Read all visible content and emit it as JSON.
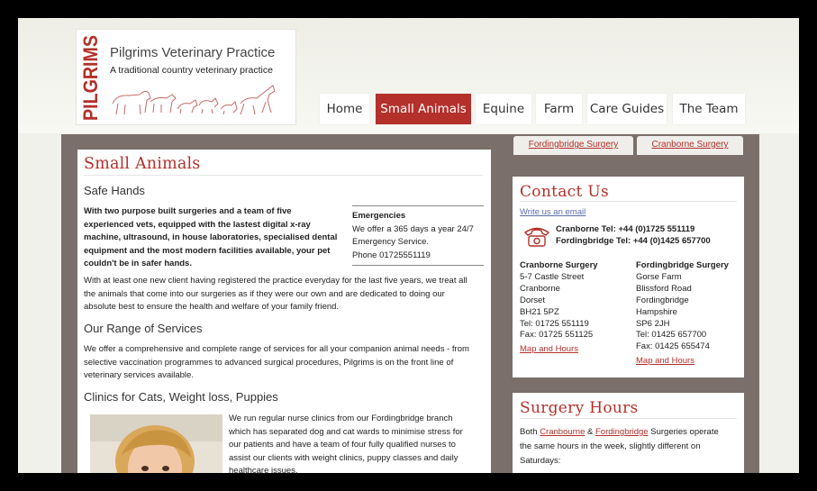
{
  "logo": {
    "vertical": "PILGRIMS",
    "name": "Pilgrims Veterinary Practice",
    "tagline": "A traditional country veterinary practice"
  },
  "nav": [
    {
      "label": "Home",
      "active": false
    },
    {
      "label": "Small Animals",
      "active": true
    },
    {
      "label": "Equine",
      "active": false
    },
    {
      "label": "Farm",
      "active": false
    },
    {
      "label": "Care Guides",
      "active": false
    },
    {
      "label": "The Team",
      "active": false
    }
  ],
  "tabs": [
    "Fordingbridge Surgery",
    "Cranborne Surgery"
  ],
  "main": {
    "title": "Small Animals",
    "safe_hands": {
      "heading": "Safe Hands",
      "bold_lines": [
        "With two purpose built surgeries and a team of five",
        "experienced vets, equipped with the lastest digital x-ray",
        "machine, ultrasound, in house laboratories, specialised dental",
        "equipment and the most modern facilities available, your pet",
        "couldn't be in safer hands."
      ],
      "para_lines": [
        "With at least one new client having registered the practice everyday for the last five years, we treat all",
        "the animals that come into our surgeries as if they were our own and are dedicated to doing our",
        "absolute best to ensure the health and welfare of your family friend."
      ]
    },
    "emergencies": {
      "title": "Emergencies",
      "lines": [
        "We offer a 365 days a year 24/7",
        "Emergency Service.",
        "Phone 01725551119"
      ]
    },
    "range": {
      "heading": "Our Range of Services",
      "lines": [
        "We offer a comprehensive and complete range of services for all your companion animal needs - from",
        "selective vaccination programmes to advanced surgical procedures, Pilgrims is on the front line of",
        "veterinary services available."
      ]
    },
    "clinics": {
      "heading": "Clinics for Cats, Weight loss, Puppies",
      "lines": [
        "We run regular nurse clinics from our Fordingbridge branch",
        "which has separated dog and cat wards to minimise stress for",
        "our patients and have a team of four fully qualified nurses to",
        "assist our clients with weight clinics, puppy classes and daily",
        "healthcare issues."
      ]
    }
  },
  "contact": {
    "title": "Contact Us",
    "email_link": "Write us an email",
    "phones": [
      "Cranborne Tel: +44 (0)1725 551119",
      "Fordingbridge Tel: +44 (0)1425 657700"
    ],
    "cranborne": {
      "title": "Cranborne Surgery",
      "lines": [
        "5-7 Castle Street",
        "Cranborne",
        "Dorset",
        "BH21 5PZ",
        "Tel: 01725 551119",
        "Fax: 01725 551125"
      ],
      "link": "Map and Hours"
    },
    "fordingbridge": {
      "title": "Fordingbridge Surgery",
      "lines": [
        "Gorse Farm",
        "Blissford Road",
        "Fordingbridge",
        "Hampshire",
        "SP6 2JH",
        "Tel: 01425 657700",
        "Fax: 01425 655474"
      ],
      "link": "Map and Hours"
    }
  },
  "hours": {
    "title": "Surgery Hours",
    "prefix": "Both ",
    "link1": "Cranbourne",
    "amp": " & ",
    "link2": "Fordingbridge",
    "suffix": " Surgeries operate",
    "line2": "the same hours in the week, slightly different on",
    "line3": "Saturdays:"
  },
  "colors": {
    "accent": "#b3302b",
    "content_bg": "#7a6f6a",
    "page_bg": "#f1f1ec"
  }
}
